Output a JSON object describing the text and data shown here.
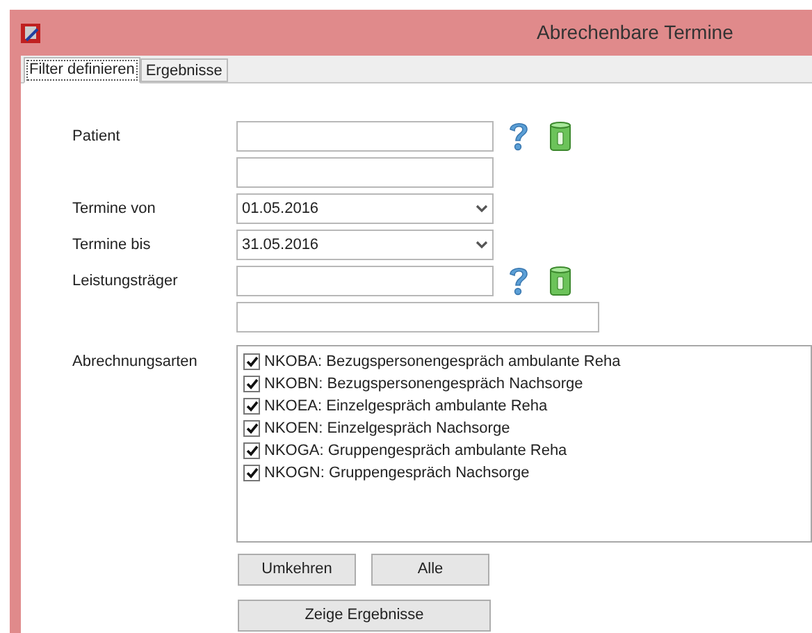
{
  "window": {
    "title": "Abrechenbare Termine"
  },
  "tabs": [
    {
      "label": "Filter definieren",
      "selected": true
    },
    {
      "label": "Ergebnisse",
      "selected": false
    }
  ],
  "form": {
    "patient": {
      "label": "Patient"
    },
    "termine_von": {
      "label": "Termine von",
      "value": "01.05.2016"
    },
    "termine_bis": {
      "label": "Termine bis",
      "value": "31.05.2016"
    },
    "leistungstraeger": {
      "label": "Leistungsträger"
    },
    "abrechnungsarten": {
      "label": "Abrechnungsarten",
      "items": [
        {
          "label": "NKOBA: Bezugspersonengespräch ambulante Reha",
          "checked": true
        },
        {
          "label": "NKOBN: Bezugspersonengespräch Nachsorge",
          "checked": true
        },
        {
          "label": "NKOEA: Einzelgespräch ambulante Reha",
          "checked": true
        },
        {
          "label": "NKOEN: Einzelgespräch Nachsorge",
          "checked": true
        },
        {
          "label": "NKOGA: Gruppengespräch ambulante Reha",
          "checked": true
        },
        {
          "label": "NKOGN: Gruppengespräch Nachsorge",
          "checked": true
        }
      ]
    }
  },
  "buttons": [
    "Umkehren",
    "Alle"
  ],
  "submit": "Zeige Ergebnisse"
}
